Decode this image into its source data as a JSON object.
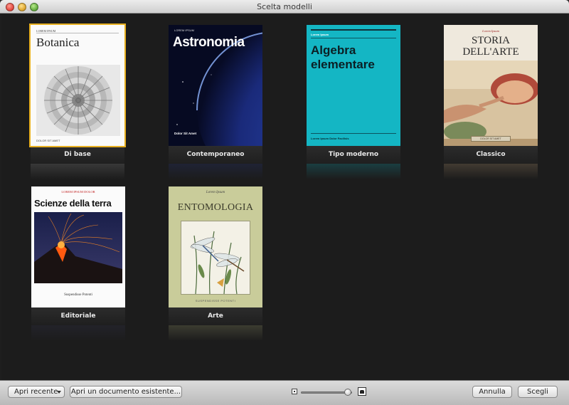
{
  "window": {
    "title": "Scelta modelli"
  },
  "templates": [
    {
      "name": "Di base",
      "selected": true,
      "cover": {
        "small": "LOREM IPSUM",
        "title": "Botanica",
        "foot": "DOLOR SIT AMET"
      }
    },
    {
      "name": "Contemporaneo",
      "selected": false,
      "cover": {
        "small": "LOREM IPSUM",
        "title": "Astronomia",
        "foot": "Dolor Sit Amet"
      }
    },
    {
      "name": "Tipo moderno",
      "selected": false,
      "cover": {
        "small": "Lorem Ipsum",
        "title": "Algebra elementare",
        "foot": "Lorem Ipsum Dolor Facilisis"
      }
    },
    {
      "name": "Classico",
      "selected": false,
      "cover": {
        "small": "Lorem Ipsum",
        "title_line1": "STORIA",
        "title_line2": "DELL'ARTE",
        "foot": "DOLOR SIT AMET"
      }
    },
    {
      "name": "Editoriale",
      "selected": false,
      "cover": {
        "small": "LOREM IPSUM DOLOR",
        "title": "Scienze della terra",
        "foot": "Suspendisse Potenti"
      }
    },
    {
      "name": "Arte",
      "selected": false,
      "cover": {
        "small": "Lorem Ipsum",
        "title": "ENTOMOLOGIA",
        "foot": "SUSPENDISSE POTENTI"
      }
    }
  ],
  "toolbar": {
    "recent_label": "Apri recente",
    "open_existing_label": "Apri un documento esistente...",
    "cancel_label": "Annulla",
    "choose_label": "Scegli",
    "zoom_level": 0.92
  },
  "colors": {
    "selection": "#e8b020",
    "algebra_cover": "#14b6c4",
    "background": "#1c1c1c"
  }
}
